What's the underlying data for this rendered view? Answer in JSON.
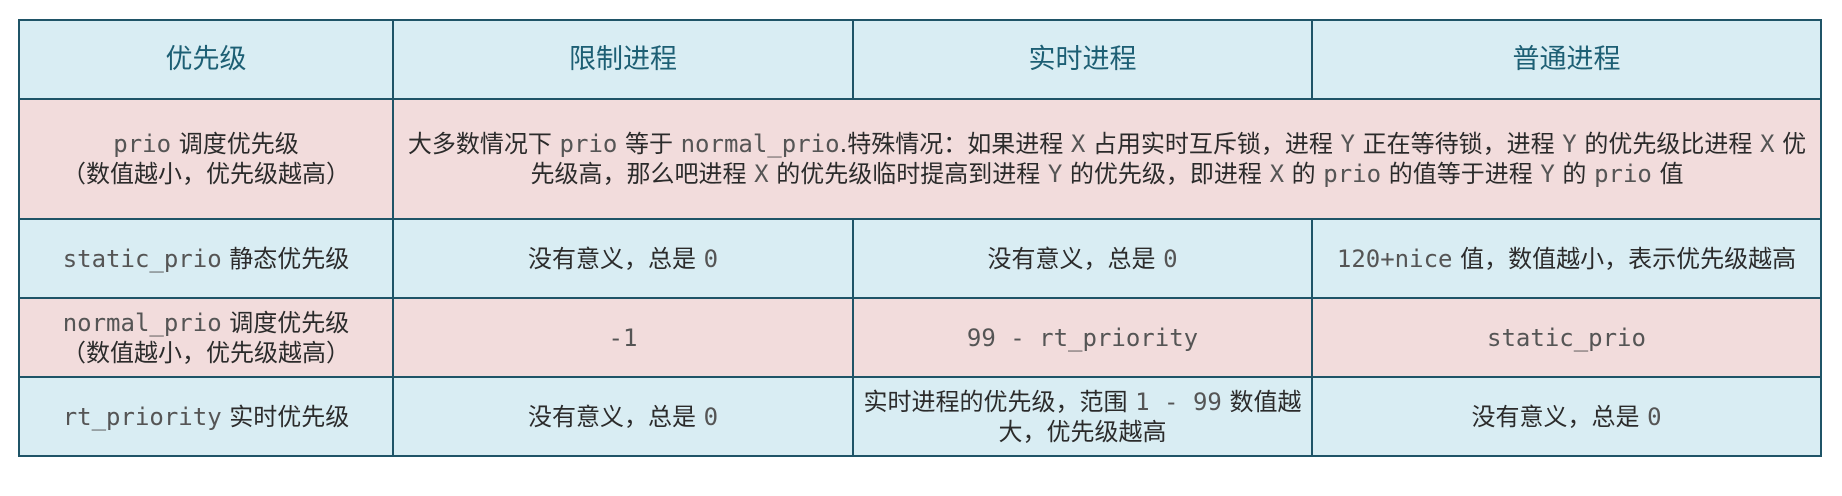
{
  "headers": [
    "优先级",
    "限制进程",
    "实时进程",
    "普通进程"
  ],
  "rows": {
    "prio": {
      "label_code": "prio",
      "label_text": " 调度优先级",
      "label_note": "（数值越小，优先级越高）",
      "desc": [
        {
          "t": "大多数情况下 "
        },
        {
          "c": "prio"
        },
        {
          "t": " 等于 "
        },
        {
          "c": "normal_prio"
        },
        {
          "t": ".特殊情况：如果进程 "
        },
        {
          "c": "X"
        },
        {
          "t": " 占用实时互斥锁，进程 "
        },
        {
          "c": "Y"
        },
        {
          "t": " 正在等待锁，进程 "
        },
        {
          "c": "Y"
        },
        {
          "t": " 的优先级比进程 "
        },
        {
          "c": "X"
        },
        {
          "t": " 优先级高，那么吧进程 "
        },
        {
          "c": "X"
        },
        {
          "t": " 的优先级临时提高到进程 "
        },
        {
          "c": "Y"
        },
        {
          "t": " 的优先级，即进程 "
        },
        {
          "c": "X"
        },
        {
          "t": " 的 "
        },
        {
          "c": "prio"
        },
        {
          "t": " 的值等于进程 "
        },
        {
          "c": "Y"
        },
        {
          "t": " 的 "
        },
        {
          "c": "prio"
        },
        {
          "t": " 值"
        }
      ]
    },
    "static_prio": {
      "label_code": "static_prio",
      "label_text": " 静态优先级",
      "limited_text": "没有意义，总是 ",
      "limited_code": "0",
      "realtime_text": "没有意义，总是 ",
      "realtime_code": "0",
      "normal_code": "120+nice",
      "normal_text": " 值，数值越小，表示优先级越高"
    },
    "normal_prio": {
      "label_code": "normal_prio",
      "label_text": " 调度优先级",
      "label_note": "（数值越小，优先级越高）",
      "limited_code": "-1",
      "realtime_code": "99 - rt_priority",
      "normal_code": "static_prio"
    },
    "rt_priority": {
      "label_code": "rt_priority",
      "label_text": " 实时优先级",
      "limited_text": "没有意义，总是 ",
      "limited_code": "0",
      "realtime_text1": "实时进程的优先级，范围 ",
      "realtime_code": "1 - 99",
      "realtime_text2": " 数值越大，优先级越高",
      "normal_text": "没有意义，总是 ",
      "normal_code": "0"
    }
  }
}
